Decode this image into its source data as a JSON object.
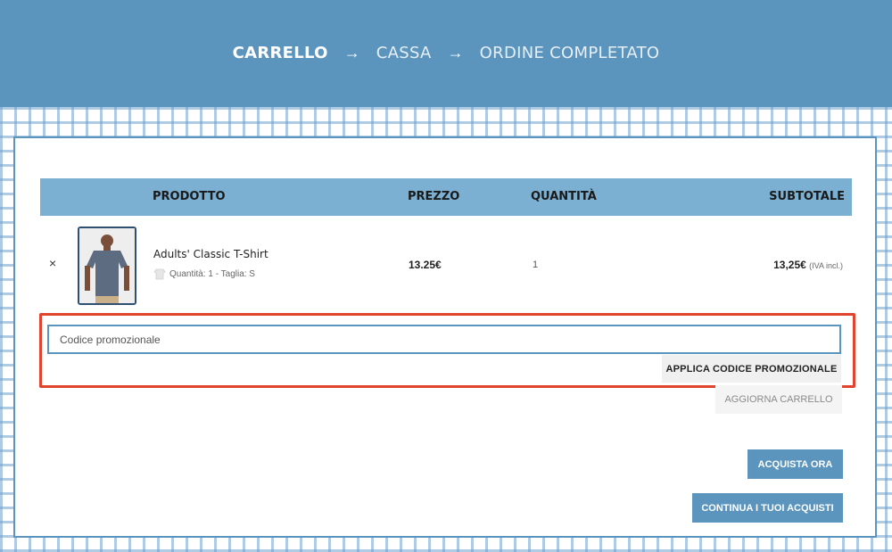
{
  "checkout_steps": {
    "cart": "CARRELLO",
    "arrow1": "→",
    "checkout": "CASSA",
    "arrow2": "→",
    "complete": "ORDINE COMPLETATO"
  },
  "table": {
    "headers": {
      "product": "PRODOTTO",
      "price": "PREZZO",
      "quantity": "QUANTITÀ",
      "subtotal": "SUBTOTALE"
    },
    "rows": [
      {
        "remove_label": "×",
        "name": "Adults' Classic T-Shirt",
        "meta": "Quantità: 1 - Taglia: S",
        "price": "13.25€",
        "quantity": "1",
        "subtotal": "13,25€",
        "tax_note": "(IVA incl.)"
      }
    ]
  },
  "promo": {
    "placeholder": "Codice promozionale",
    "value": "",
    "apply_label": "APPLICA CODICE PROMOZIONALE"
  },
  "actions": {
    "update_cart": "AGGIORNA CARRELLO",
    "buy_now": "ACQUISTA ORA",
    "continue_shopping": "CONTINUA I TUOI ACQUISTI"
  },
  "colors": {
    "brand": "#5b95bd",
    "table_header": "#7cb0d3",
    "highlight": "#e0442c"
  }
}
